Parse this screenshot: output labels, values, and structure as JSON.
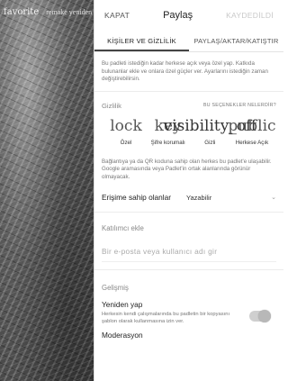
{
  "background": {
    "title": "favorite",
    "subtitle": "remake yeniden"
  },
  "topbar": {
    "close_label": "KAPAT",
    "title": "Paylaş",
    "save_label": "KAYDEDİLDİ"
  },
  "tabs": [
    {
      "label": "KİŞİLER VE GİZLİLİK",
      "active": true
    },
    {
      "label": "PAYLAŞ/AKTAR/KATIŞTIR",
      "active": false
    }
  ],
  "intro_text": "Bu padleti istediğin kadar herkese açık veya özel yap. Katkıda bulunanlar ekle ve onlara özel güçler ver. Ayarlarını istediğin zaman değiştirebilirsin.",
  "privacy": {
    "title": "Gizlilik",
    "more_options_label": "BU SEÇENEKLER NELERDİR?",
    "options": [
      {
        "icon": "lock",
        "icon_name": "lock-icon",
        "label": "Özel"
      },
      {
        "icon": "key",
        "icon_name": "key-icon",
        "label": "Şifre korumalı"
      },
      {
        "icon": "visibility_off",
        "icon_name": "visibility-off-icon",
        "label": "Gizli"
      },
      {
        "icon": "public",
        "icon_name": "public-icon",
        "label": "Herkese Açık"
      }
    ],
    "selected_label": "Gizli",
    "description": "Bağlantıya ya da QR koduna sahip olan herkes bu padlet'e ulaşabilir. Google aramasında veya Padlet'in ortak alanlarında görünür olmayacak."
  },
  "access": {
    "label": "Erişime sahip olanlar",
    "value": "Yazabilir"
  },
  "collaborators": {
    "title": "Katılımcı ekle",
    "placeholder": "Bir e-posta veya kullanıcı adı gir"
  },
  "advanced": {
    "title": "Gelişmiş",
    "remake_title": "Yeniden yap",
    "remake_description": "Herkesin kendi çalışmalarında bu padletin bir kopyasını şablon olarak kullanmasına izin ver.",
    "remake_enabled": true,
    "moderation_title": "Moderasyon"
  }
}
